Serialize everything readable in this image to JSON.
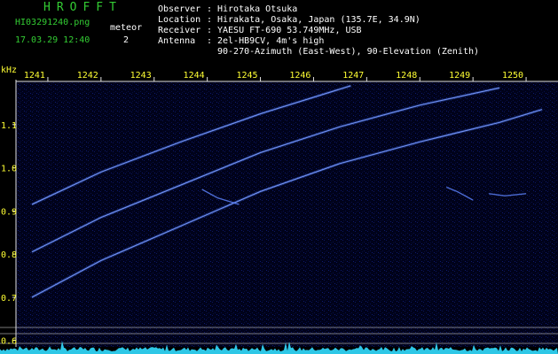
{
  "header": {
    "brand": "HROFFT",
    "filename": "HI03291240.png",
    "datetime": "17.03.29 12:40",
    "meteor_label": "meteor",
    "meteor_count": "2"
  },
  "station": {
    "observer_label": "Observer",
    "observer": "Hirotaka Otsuka",
    "location_label": "Location",
    "location": "Hirakata, Osaka, Japan (135.7E, 34.9N)",
    "receiver_label": "Receiver",
    "receiver": "YAESU FT-690 53.749MHz, USB",
    "antenna_label": "Antenna",
    "antenna": "2el-HB9CV, 4m's high",
    "antenna_detail": "90-270-Azimuth (East-West), 90-Elevation (Zenith)"
  },
  "colors": {
    "background": "#000000",
    "green_text": "#33cc33",
    "yellow_text": "#ffff33",
    "trace": "#4a78ff",
    "spectrum_bottom": "#33ddff"
  },
  "chart_data": {
    "type": "spectrogram",
    "ylabel": "kHz",
    "x_ticks": [
      "1241",
      "1242",
      "1243",
      "1244",
      "1245",
      "1246",
      "1247",
      "1248",
      "1249",
      "1250"
    ],
    "y_ticks": [
      "1.1",
      "1.0",
      "0.9",
      "0.8",
      "0.7",
      "0.6"
    ],
    "traces": [
      {
        "x": [
          1240.7,
          1242.0,
          1243.5,
          1245.0,
          1246.7
        ],
        "y": [
          0.915,
          0.99,
          1.06,
          1.125,
          1.19
        ]
      },
      {
        "x": [
          1240.7,
          1242.0,
          1243.5,
          1245.0,
          1246.5,
          1248.0,
          1249.5
        ],
        "y": [
          0.805,
          0.885,
          0.96,
          1.035,
          1.095,
          1.145,
          1.185
        ]
      },
      {
        "x": [
          1240.7,
          1242.0,
          1243.5,
          1245.0,
          1246.5,
          1248.0,
          1249.5,
          1250.3
        ],
        "y": [
          0.7,
          0.785,
          0.865,
          0.945,
          1.01,
          1.06,
          1.105,
          1.135
        ]
      }
    ],
    "echo_marks": [
      {
        "x": [
          1243.9,
          1244.2,
          1244.6
        ],
        "y": [
          0.95,
          0.93,
          0.915
        ]
      },
      {
        "x": [
          1248.5,
          1248.7,
          1249.0
        ],
        "y": [
          0.955,
          0.945,
          0.925
        ]
      },
      {
        "x": [
          1249.3,
          1249.6,
          1250.0
        ],
        "y": [
          0.94,
          0.935,
          0.94
        ]
      }
    ],
    "xlim": [
      1240.4,
      1250.6
    ],
    "ylim": [
      0.585,
      1.2
    ]
  }
}
